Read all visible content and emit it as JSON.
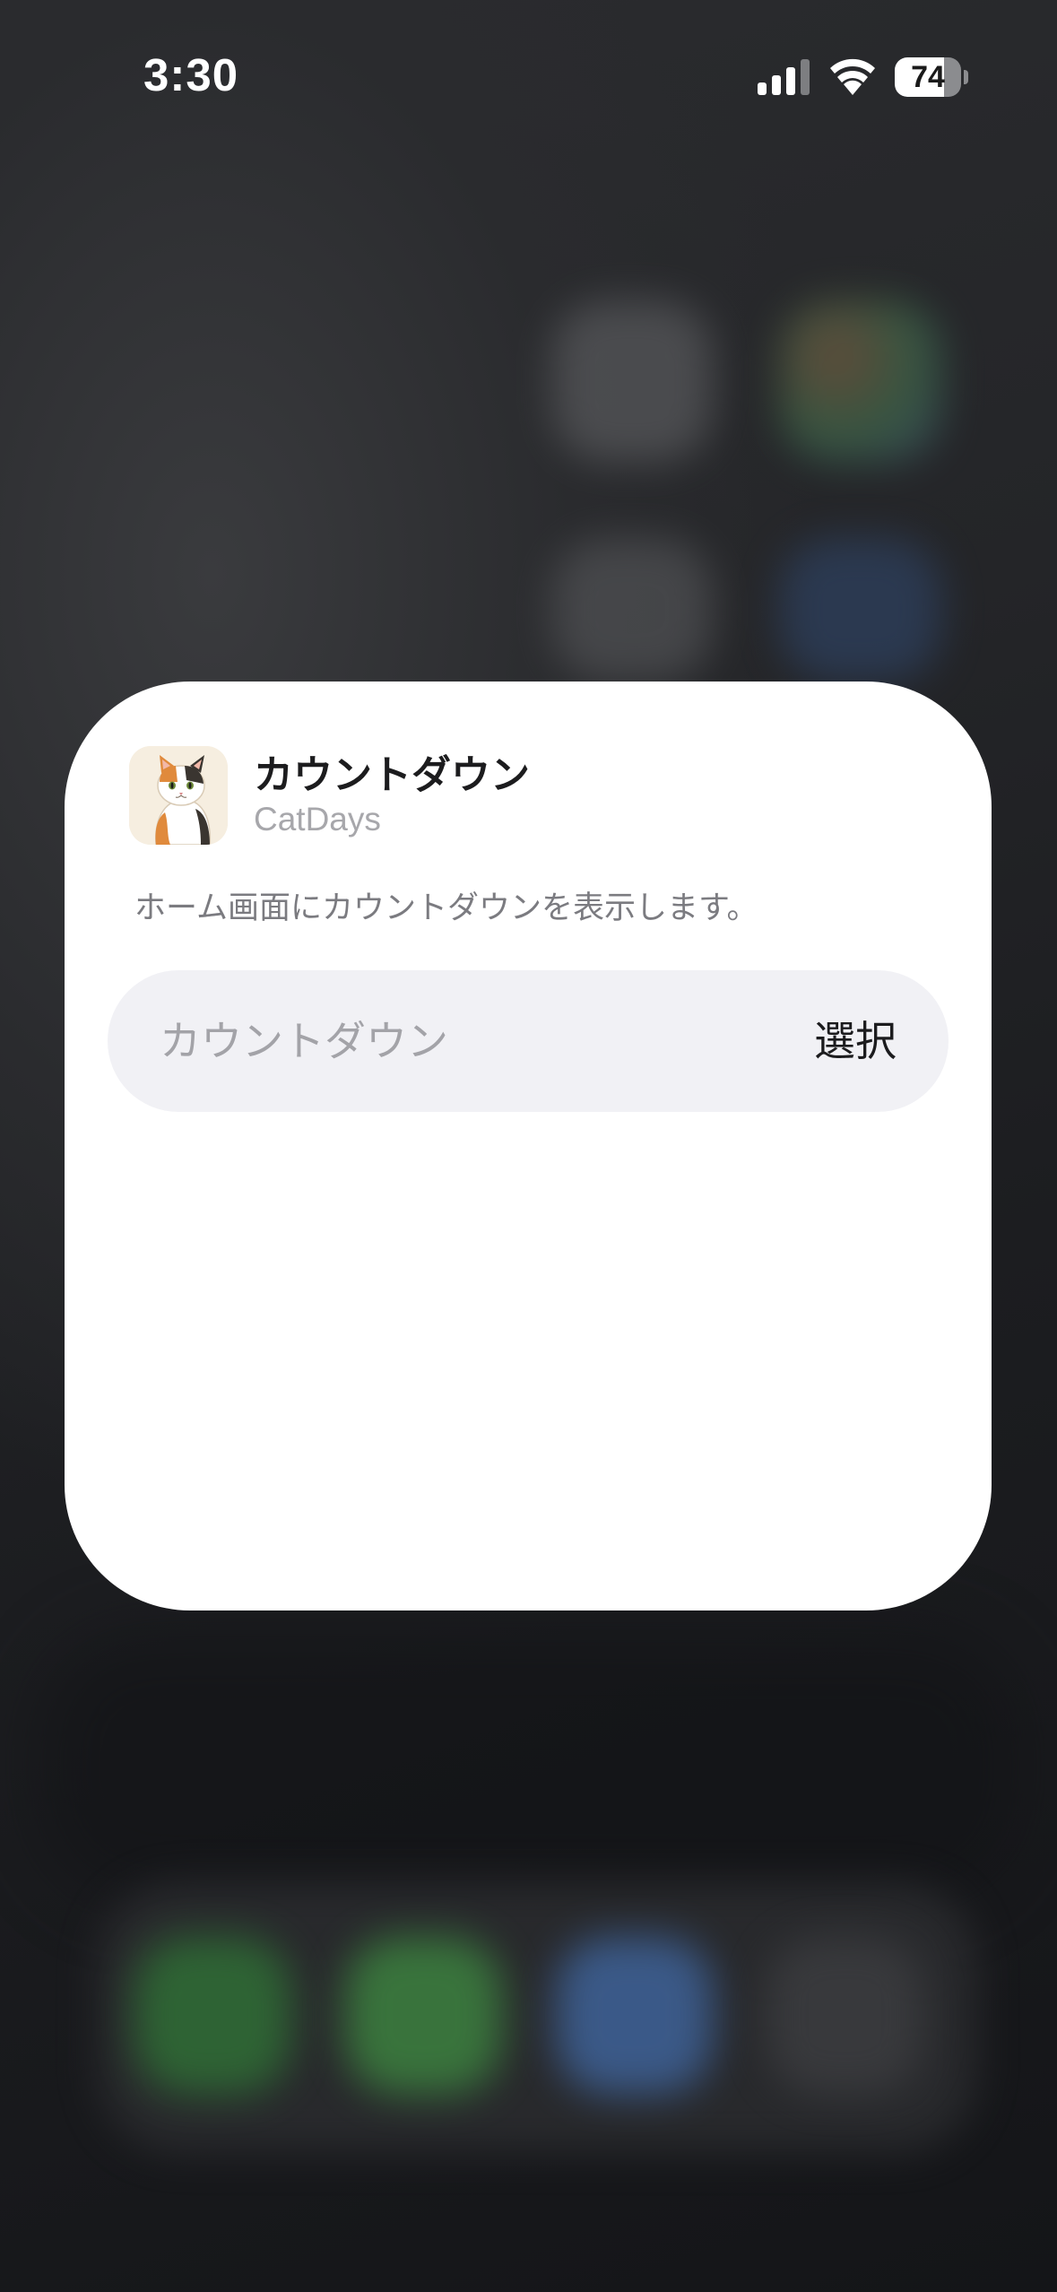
{
  "status_bar": {
    "time": "3:30",
    "battery_level": "74",
    "battery_fraction": 0.74,
    "signal_icon": "cellular-signal-icon",
    "wifi_icon": "wifi-icon"
  },
  "widget": {
    "title": "カウントダウン",
    "app_name": "CatDays",
    "app_icon": "calico-cat-icon",
    "description": "ホーム画面にカウントダウンを表示します。",
    "parameter": {
      "label": "カウントダウン",
      "action": "選択"
    }
  },
  "colors": {
    "card_background": "#ffffff",
    "field_background": "#f1f1f5",
    "secondary_text": "#a7a7ab",
    "primary_text": "#1c1c1e"
  }
}
